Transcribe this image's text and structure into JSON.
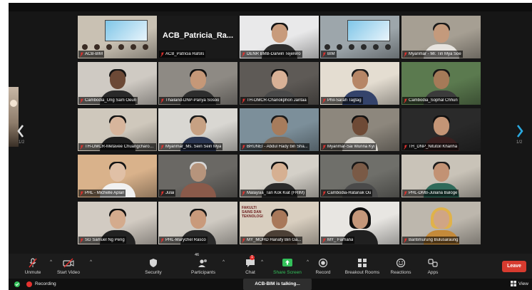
{
  "pagination": {
    "prev_label": "1/2",
    "next_label": "1/2"
  },
  "participants": [
    {
      "name": "ACB-BIM",
      "bg": "#c9c1b3",
      "skin": "#c7a08a",
      "shirt": "#6a5d52",
      "hair": "#3a2c24",
      "type": "room"
    },
    {
      "name": "ACB_Patricia Rafols",
      "big": "ACB_Patricia_Ra...",
      "type": "black"
    },
    {
      "name": "DENR BMB-Darwin Tejerero",
      "bg": "#e9e9ea",
      "skin": "#c89b7c",
      "shirt": "#2d2d2d",
      "hair": "#151515"
    },
    {
      "name": "BIM",
      "bg": "#9da6ab",
      "skin": "#8a7a6e",
      "shirt": "#4d5f70",
      "hair": "#2a2a2a",
      "type": "room"
    },
    {
      "name": "Myanmar - Mr. Tin Mya Soe",
      "bg": "#a69f93",
      "skin": "#c49a7c",
      "shirt": "#e6e3de",
      "hair": "#1a1a1a"
    },
    {
      "name": "Cambodia_Ung Sam Oeun",
      "bg": "#cfcac3",
      "skin": "#6c4936",
      "shirt": "#2a2a2a",
      "hair": "#141414"
    },
    {
      "name": "Thailand-DNP-Panya Sosoo",
      "bg": "#8e8a84",
      "skin": "#c59878",
      "shirt": "#2e2e2e",
      "hair": "#111111"
    },
    {
      "name": "TH-DMCR-Chanokphon Jantaa",
      "bg": "#5e5a56",
      "skin": "#d8b196",
      "shirt": "#4a4a4a",
      "hair": "#101010"
    },
    {
      "name": "Phil-Sarah Tagtag",
      "bg": "#e4ddd1",
      "skin": "#b68666",
      "shirt": "#34436b",
      "hair": "#1b1b1b"
    },
    {
      "name": "Cambodia_Sophal Chhun",
      "bg": "#5b7a4f",
      "skin": "#a57a58",
      "shirt": "#3b3b3b",
      "hair": "#161616"
    },
    {
      "name": "TH-DMCR-Metavee Chuangcharoendee",
      "bg": "#cfc8bc",
      "skin": "#d7b59c",
      "shirt": "#1e1e1e",
      "hair": "#121212"
    },
    {
      "name": "Myanmar_Ms. Sein Sein Mya",
      "bg": "#d9d7d2",
      "skin": "#c7a183",
      "shirt": "#2a3550",
      "hair": "#181818"
    },
    {
      "name": "BRUNEI - Abdul Hady bin Sha...",
      "bg": "#7c8f9a",
      "skin": "#a77c5c",
      "shirt": "#7b6c5e",
      "hair": "#1a1a1a"
    },
    {
      "name": "Myanmar-Sai Wunna Kyi",
      "bg": "#8d877d",
      "skin": "#6e4a36",
      "shirt": "#d7d3cc",
      "hair": "#111111"
    },
    {
      "name": "TH_DNP_Nitutoil Khanha",
      "bg": "#2a2a2a",
      "skin": "#c49576",
      "shirt": "#3a2020",
      "hair": "#0f0f0f"
    },
    {
      "name": "PHL - Michelle Aplan",
      "bg": "#d9b28b",
      "skin": "#e0c0a6",
      "shirt": "#f1f1f1",
      "hair": "#141414"
    },
    {
      "name": "Julai",
      "bg": "#6a6864",
      "skin": "#b6947c",
      "shirt": "#8a5a4a",
      "hair": "#d8d8d8"
    },
    {
      "name": "Malaysia_Tan Kok Kiat (FRIM)",
      "bg": "#d4d0c8",
      "skin": "#d6b092",
      "shirt": "#2b2b2b",
      "hair": "#121212"
    },
    {
      "name": "Cambodia-Ratanak Ou",
      "bg": "#6f6f6a",
      "skin": "#7a5a46",
      "shirt": "#4a4a4a",
      "hair": "#181818"
    },
    {
      "name": "PHL-DMB-Juliana Baloge",
      "bg": "#c9c3b8",
      "skin": "#c29274",
      "shirt": "#2f6a5a",
      "hair": "#1c1c1c"
    },
    {
      "name": "SG Samuel Ng Peng",
      "bg": "#d2cbc2",
      "skin": "#d4ab8d",
      "shirt": "#222222",
      "hair": "#0f0f0f"
    },
    {
      "name": "PHL-Marychel Rasco",
      "bg": "#cfcac2",
      "skin": "#c99a7b",
      "shirt": "#2a2a2a",
      "hair": "#151515"
    },
    {
      "name": "MY_MOHD Hanafy Bin Ga...",
      "bg": "#d9cfc0",
      "skin": "#a8785a",
      "shirt": "#4c4036",
      "hair": "#1a1a1a",
      "type": "banner",
      "banner": "FAKULTI SAINS DAN TEKNOLOGI"
    },
    {
      "name": "MY_ Farhana",
      "bg": "#e8e6e2",
      "skin": "#c4977a",
      "shirt": "#202020",
      "hair": "#101010",
      "hijab": true
    },
    {
      "name": "Bantimurung Bulusaraung",
      "bg": "#bdb7ad",
      "skin": "#d0a585",
      "shirt": "#c48a3a",
      "hair": "#e0b24a",
      "hijab": true
    }
  ],
  "toolbar": {
    "unmute": "Unmute",
    "start_video": "Start Video",
    "security": "Security",
    "participants": "Participants",
    "participants_count": "46",
    "chat": "Chat",
    "chat_badge": "1",
    "share_screen": "Share Screen",
    "record": "Record",
    "breakout": "Breakout Rooms",
    "reactions": "Reactions",
    "apps": "Apps",
    "leave": "Leave"
  },
  "status": {
    "recording": "Recording",
    "talking": "ACB-BIM is talking...",
    "view": "View"
  },
  "colors": {
    "active_speaker": "#d9d65b",
    "share": "#33c15a",
    "leave": "#d73b2f",
    "recording": "#e5322f"
  }
}
